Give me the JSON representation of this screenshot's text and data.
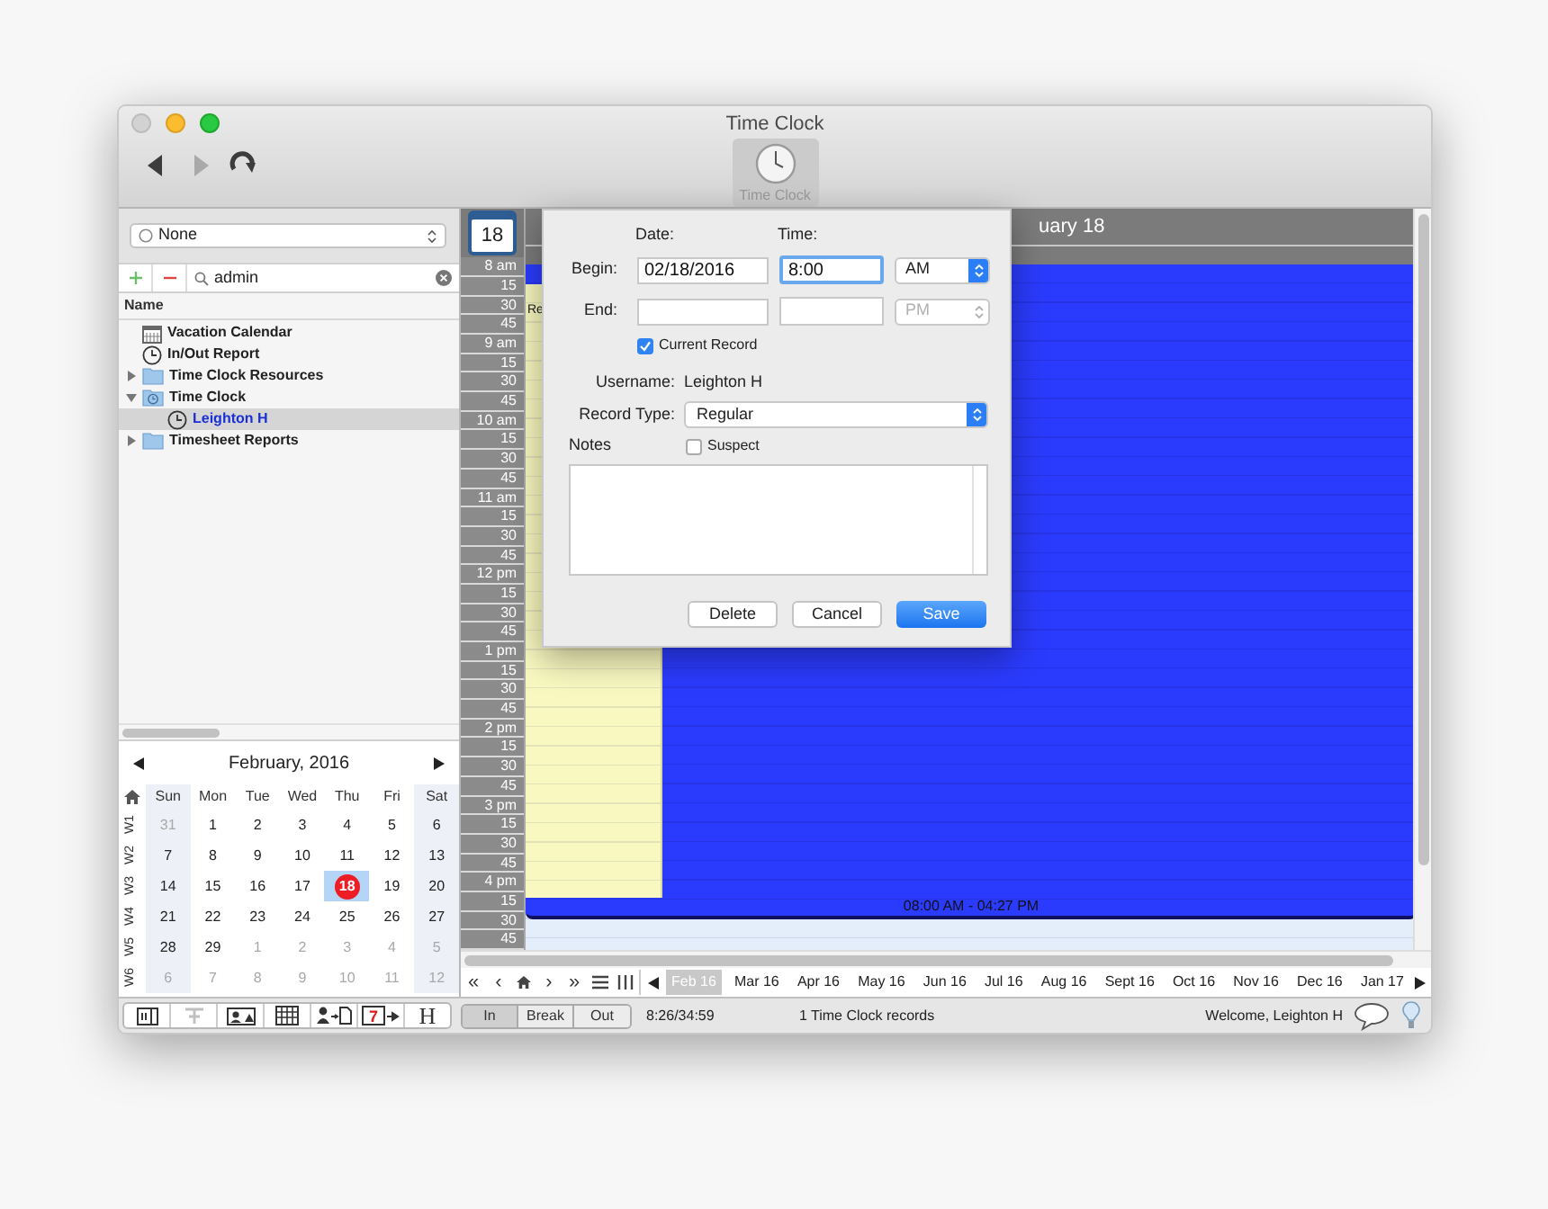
{
  "window": {
    "title": "Time Clock"
  },
  "nav_buttons": [
    {
      "kind": "back",
      "disabled": false
    },
    {
      "kind": "forward",
      "disabled": true
    },
    {
      "kind": "reload",
      "disabled": false
    }
  ],
  "toolbar_items": [
    {
      "label": "Time Clock",
      "selected": true
    }
  ],
  "sidebar": {
    "filter": "None",
    "search": "admin",
    "column_header": "Name",
    "tree": [
      {
        "label": "Vacation Calendar",
        "kind": "calendar",
        "selected": false
      },
      {
        "label": "In/Out Report",
        "kind": "clock",
        "selected": false
      },
      {
        "label": "Time Clock Resources",
        "kind": "folder",
        "expanded": false,
        "selected": false
      },
      {
        "label": "Time Clock",
        "kind": "clock-folder",
        "expanded": true,
        "selected": false,
        "children": [
          {
            "label": "Leighton H",
            "kind": "clock",
            "selected": true
          }
        ]
      },
      {
        "label": "Timesheet Reports",
        "kind": "folder",
        "expanded": false,
        "selected": false
      }
    ]
  },
  "mini_calendar": {
    "title": "February, 2016",
    "weekdays": [
      "Sun",
      "Mon",
      "Tue",
      "Wed",
      "Thu",
      "Fri",
      "Sat"
    ],
    "weeks": [
      {
        "label": "W1",
        "days": [
          {
            "day": "31",
            "muted": true,
            "selected": false,
            "today": false
          },
          {
            "day": "1",
            "muted": false,
            "selected": false,
            "today": false
          },
          {
            "day": "2",
            "muted": false,
            "selected": false,
            "today": false
          },
          {
            "day": "3",
            "muted": false,
            "selected": false,
            "today": false
          },
          {
            "day": "4",
            "muted": false,
            "selected": false,
            "today": false
          },
          {
            "day": "5",
            "muted": false,
            "selected": false,
            "today": false
          },
          {
            "day": "6",
            "muted": false,
            "selected": false,
            "today": false
          }
        ]
      },
      {
        "label": "W2",
        "days": [
          {
            "day": "7",
            "muted": false,
            "selected": false,
            "today": false
          },
          {
            "day": "8",
            "muted": false,
            "selected": false,
            "today": false
          },
          {
            "day": "9",
            "muted": false,
            "selected": false,
            "today": false
          },
          {
            "day": "10",
            "muted": false,
            "selected": false,
            "today": false
          },
          {
            "day": "11",
            "muted": false,
            "selected": false,
            "today": false
          },
          {
            "day": "12",
            "muted": false,
            "selected": false,
            "today": false
          },
          {
            "day": "13",
            "muted": false,
            "selected": false,
            "today": false
          }
        ]
      },
      {
        "label": "W3",
        "days": [
          {
            "day": "14",
            "muted": false,
            "selected": false,
            "today": false
          },
          {
            "day": "15",
            "muted": false,
            "selected": false,
            "today": false
          },
          {
            "day": "16",
            "muted": false,
            "selected": false,
            "today": false
          },
          {
            "day": "17",
            "muted": false,
            "selected": false,
            "today": false
          },
          {
            "day": "18",
            "muted": false,
            "selected": true,
            "today": true
          },
          {
            "day": "19",
            "muted": false,
            "selected": false,
            "today": false
          },
          {
            "day": "20",
            "muted": false,
            "selected": false,
            "today": false
          }
        ]
      },
      {
        "label": "W4",
        "days": [
          {
            "day": "21",
            "muted": false,
            "selected": false,
            "today": false
          },
          {
            "day": "22",
            "muted": false,
            "selected": false,
            "today": false
          },
          {
            "day": "23",
            "muted": false,
            "selected": false,
            "today": false
          },
          {
            "day": "24",
            "muted": false,
            "selected": false,
            "today": false
          },
          {
            "day": "25",
            "muted": false,
            "selected": false,
            "today": false
          },
          {
            "day": "26",
            "muted": false,
            "selected": false,
            "today": false
          },
          {
            "day": "27",
            "muted": false,
            "selected": false,
            "today": false
          }
        ]
      },
      {
        "label": "W5",
        "days": [
          {
            "day": "28",
            "muted": false,
            "selected": false,
            "today": false
          },
          {
            "day": "29",
            "muted": false,
            "selected": false,
            "today": false
          },
          {
            "day": "1",
            "muted": true,
            "selected": false,
            "today": false
          },
          {
            "day": "2",
            "muted": true,
            "selected": false,
            "today": false
          },
          {
            "day": "3",
            "muted": true,
            "selected": false,
            "today": false
          },
          {
            "day": "4",
            "muted": true,
            "selected": false,
            "today": false
          },
          {
            "day": "5",
            "muted": true,
            "selected": false,
            "today": false
          }
        ]
      },
      {
        "label": "W6",
        "days": [
          {
            "day": "6",
            "muted": true,
            "selected": false,
            "today": false
          },
          {
            "day": "7",
            "muted": true,
            "selected": false,
            "today": false
          },
          {
            "day": "8",
            "muted": true,
            "selected": false,
            "today": false
          },
          {
            "day": "9",
            "muted": true,
            "selected": false,
            "today": false
          },
          {
            "day": "10",
            "muted": true,
            "selected": false,
            "today": false
          },
          {
            "day": "11",
            "muted": true,
            "selected": false,
            "today": false
          },
          {
            "day": "12",
            "muted": true,
            "selected": false,
            "today": false
          }
        ]
      }
    ]
  },
  "bottom_toolbar": [
    {
      "kind": "sidebar",
      "disabled": false
    },
    {
      "kind": "tree",
      "disabled": true
    },
    {
      "kind": "card",
      "disabled": false
    },
    {
      "kind": "grid",
      "disabled": false
    },
    {
      "kind": "person-doc",
      "disabled": false
    },
    {
      "kind": "calendar",
      "text": "7",
      "disabled": false
    },
    {
      "kind": "letter",
      "text": "H",
      "disabled": false
    }
  ],
  "day_view": {
    "date_button": "18",
    "header": "uary 18",
    "times": [
      "8 am",
      "15",
      "30",
      "45",
      "9 am",
      "15",
      "30",
      "45",
      "10 am",
      "15",
      "30",
      "45",
      "11 am",
      "15",
      "30",
      "45",
      "12 pm",
      "15",
      "30",
      "45",
      "1 pm",
      "15",
      "30",
      "45",
      "2 pm",
      "15",
      "30",
      "45",
      "3 pm",
      "15",
      "30",
      "45",
      "4 pm",
      "15",
      "30",
      "45"
    ],
    "events": [
      {
        "kind": "block",
        "label": "08:00 AM - 04:27 PM",
        "color": "#2b3bfd"
      },
      {
        "kind": "column",
        "label": "Re",
        "color": "#f8f8c0"
      }
    ],
    "nav_buttons": [
      {
        "kind": "text",
        "text": "«"
      },
      {
        "kind": "text",
        "text": "‹"
      },
      {
        "kind": "home"
      },
      {
        "kind": "text",
        "text": "›"
      },
      {
        "kind": "text",
        "text": "»"
      },
      {
        "kind": "list"
      },
      {
        "kind": "columns"
      }
    ],
    "months": [
      {
        "label": "Feb 16",
        "selected": true
      },
      {
        "label": "Mar 16",
        "selected": false
      },
      {
        "label": "Apr 16",
        "selected": false
      },
      {
        "label": "May 16",
        "selected": false
      },
      {
        "label": "Jun 16",
        "selected": false
      },
      {
        "label": "Jul 16",
        "selected": false
      },
      {
        "label": "Aug 16",
        "selected": false
      },
      {
        "label": "Sept 16",
        "selected": false
      },
      {
        "label": "Oct 16",
        "selected": false
      },
      {
        "label": "Nov 16",
        "selected": false
      },
      {
        "label": "Dec 16",
        "selected": false
      },
      {
        "label": "Jan 17",
        "selected": false
      }
    ]
  },
  "dialog": {
    "date_label": "Date:",
    "time_label": "Time:",
    "rows": [
      {
        "label": "Begin:",
        "date": "02/18/2016",
        "time": "8:00",
        "meridiem": "AM",
        "time_focused": true,
        "disabled": false
      },
      {
        "label": "End:",
        "meridiem": "PM",
        "time_focused": false,
        "disabled": true
      }
    ],
    "current_record": {
      "label": "Current Record",
      "checked": true
    },
    "username_label": "Username:",
    "username": "Leighton H",
    "record_type_label": "Record Type:",
    "record_type": "Regular",
    "notes_label": "Notes",
    "suspect": {
      "label": "Suspect",
      "checked": false
    },
    "buttons": [
      {
        "label": "Delete",
        "default": false
      },
      {
        "label": "Cancel",
        "default": false
      },
      {
        "label": "Save",
        "default": true
      }
    ]
  },
  "status_bar": {
    "punch": [
      {
        "label": "In",
        "selected": true
      },
      {
        "label": "Break",
        "selected": false
      },
      {
        "label": "Out",
        "selected": false
      }
    ],
    "timer": "8:26/34:59",
    "records": "1 Time Clock records",
    "welcome": "Welcome, Leighton H"
  }
}
